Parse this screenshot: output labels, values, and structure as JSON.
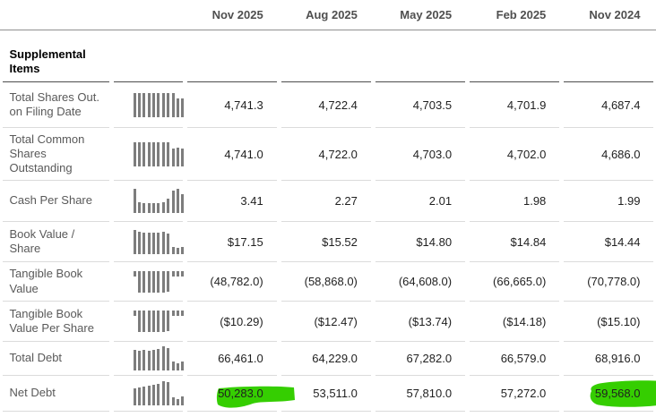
{
  "theme": {
    "highlight_green": "#35CE01",
    "sparkline_bar_gray": "#7d7d7d"
  },
  "columns": [
    "Nov 2025",
    "Aug 2025",
    "May 2025",
    "Feb 2025",
    "Nov 2024"
  ],
  "section_title": "Supplemental Items",
  "rows": [
    {
      "label": "Total Shares Out. on Filing Date",
      "values": [
        "4,741.3",
        "4,722.4",
        "4,703.5",
        "4,701.9",
        "4,687.4"
      ],
      "spark": {
        "dir": "up",
        "bars": [
          1,
          1,
          1,
          1,
          1,
          1,
          1,
          1,
          1,
          0.76,
          0.79
        ]
      },
      "highlights": []
    },
    {
      "label": "Total Common Shares Outstanding",
      "values": [
        "4,741.0",
        "4,722.0",
        "4,703.0",
        "4,702.0",
        "4,686.0"
      ],
      "spark": {
        "dir": "up",
        "bars": [
          1,
          1,
          1,
          1,
          1,
          1,
          1,
          1,
          0.73,
          0.76,
          0.73
        ]
      },
      "highlights": []
    },
    {
      "label": "Cash Per Share",
      "values": [
        "3.41",
        "2.27",
        "2.01",
        "1.98",
        "1.99"
      ],
      "spark": {
        "dir": "up",
        "bars": [
          1,
          0.46,
          0.42,
          0.4,
          0.4,
          0.42,
          0.46,
          0.58,
          0.92,
          1,
          0.78
        ]
      },
      "highlights": []
    },
    {
      "label": "Book Value / Share",
      "values": [
        "$17.15",
        "$15.52",
        "$14.80",
        "$14.84",
        "$14.44"
      ],
      "spark": {
        "dir": "up",
        "bars": [
          1,
          0.94,
          0.9,
          0.88,
          0.88,
          0.9,
          0.94,
          0.86,
          0.3,
          0.26,
          0.3
        ]
      },
      "highlights": []
    },
    {
      "label": "Tangible Book Value",
      "values": [
        "(48,782.0)",
        "(58,868.0)",
        "(64,608.0)",
        "(66,665.0)",
        "(70,778.0)"
      ],
      "spark": {
        "dir": "down",
        "bars": [
          0.26,
          1,
          1,
          1,
          1,
          1,
          1,
          0.95,
          0.26,
          0.24,
          0.26
        ]
      },
      "highlights": []
    },
    {
      "label": "Tangible Book Value Per Share",
      "values": [
        "($10.29)",
        "($12.47)",
        "($13.74)",
        "($14.18)",
        "($15.10)"
      ],
      "spark": {
        "dir": "down",
        "bars": [
          0.26,
          1,
          1,
          1,
          1,
          1,
          1,
          0.95,
          0.26,
          0.24,
          0.26
        ]
      },
      "highlights": []
    },
    {
      "label": "Total Debt",
      "values": [
        "66,461.0",
        "64,229.0",
        "67,282.0",
        "66,579.0",
        "68,916.0"
      ],
      "spark": {
        "dir": "up",
        "bars": [
          0.86,
          0.82,
          0.84,
          0.82,
          0.84,
          0.88,
          1,
          0.92,
          0.36,
          0.3,
          0.36
        ]
      },
      "highlights": []
    },
    {
      "label": "Net Debt",
      "values": [
        "50,283.0",
        "53,511.0",
        "57,810.0",
        "57,272.0",
        "59,568.0"
      ],
      "spark": {
        "dir": "up",
        "bars": [
          0.7,
          0.74,
          0.78,
          0.8,
          0.85,
          0.9,
          1,
          0.95,
          0.32,
          0.26,
          0.36
        ]
      },
      "highlights": [
        {
          "col": 0,
          "style": "swoosh"
        },
        {
          "col": 4,
          "style": "blob"
        }
      ]
    }
  ]
}
